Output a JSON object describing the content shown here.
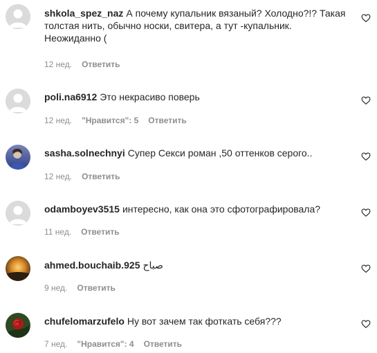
{
  "comments": [
    {
      "username": "shkola_spez_naz",
      "text": "А почему купальник вязаный? Холодно?!? Такая толстая нить, обычно носки, свитера, а тут -купальник. Неожиданно (",
      "time": "12 нед.",
      "likes": "",
      "reply": "Ответить",
      "avatar": "default-avatar-icon"
    },
    {
      "username": "poli.na6912",
      "text": "Это некрасиво поверь",
      "time": "12 нед.",
      "likes": "\"Нравится\": 5",
      "reply": "Ответить",
      "avatar": "default-avatar-icon"
    },
    {
      "username": "sasha.solnechnyi",
      "text": "Супер Секси роман ,50 оттенков серого..",
      "time": "12 нед.",
      "likes": "",
      "reply": "Ответить",
      "avatar": "photo-avatar-blue"
    },
    {
      "username": "odamboyev3515",
      "text": "интересно, как она это сфотографировала?",
      "time": "11 нед.",
      "likes": "",
      "reply": "Ответить",
      "avatar": "default-avatar-icon"
    },
    {
      "username": "ahmed.bouchaib.925",
      "text": "صباح",
      "time": "9 нед.",
      "likes": "",
      "reply": "Ответить",
      "avatar": "photo-avatar-sunset"
    },
    {
      "username": "chufelomarzufelo",
      "text": "Ну вот зачем так фоткать себя???",
      "time": "7 нед.",
      "likes": "\"Нравится\": 4",
      "reply": "Ответить",
      "avatar": "photo-avatar-rose"
    }
  ],
  "colors": {
    "text": "#262626",
    "secondary": "#8e8e8e",
    "avatar_placeholder": "#dbdbdb"
  }
}
